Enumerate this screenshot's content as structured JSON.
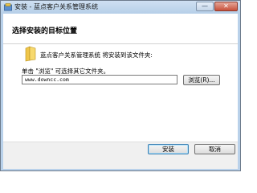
{
  "window": {
    "title": "安装 - 蓝点客户关系管理系统",
    "minimize_glyph": "—",
    "close_glyph": "✕"
  },
  "header": {
    "title": "选择安装的目标位置"
  },
  "body": {
    "info_text": "蓝点客户关系管理系统 将安装到该文件夹:",
    "instruction_text": "单击 \"浏览\" 可选择其它文件夹。",
    "path_value": "www.downcc.com",
    "browse_label": "浏览(R)..."
  },
  "footer": {
    "install_label": "安装",
    "cancel_label": "取消"
  },
  "icons": {
    "title_icon": "installer-icon",
    "folder_icon": "folder-icon"
  },
  "colors": {
    "frame": "#b9d1ea",
    "close_button": "#c7513b",
    "folder": "#f0c64a",
    "focus_border": "#3c7fb1"
  }
}
